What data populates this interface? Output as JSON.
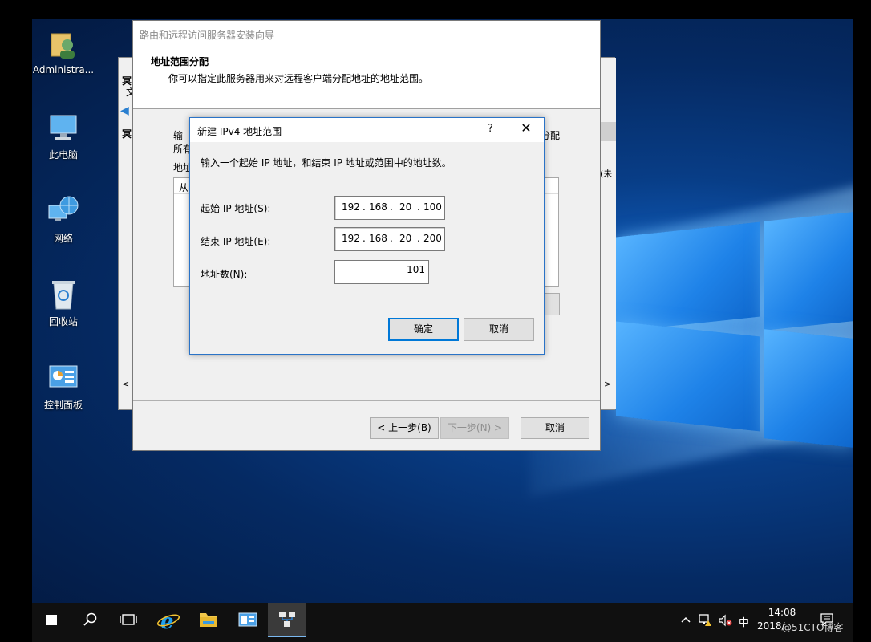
{
  "desktop": {
    "icons": [
      {
        "label": "Administra..."
      },
      {
        "label": "此电脑"
      },
      {
        "label": "网络"
      },
      {
        "label": "回收站"
      },
      {
        "label": "控制面板"
      }
    ]
  },
  "console_partial": {
    "char1": "冥",
    "char2": "文",
    "char3": "冥",
    "right_text": "(未"
  },
  "wizard": {
    "title": "路由和远程访问服务器安装向导",
    "header_title": "地址范围分配",
    "header_desc": "你可以指定此服务器用来对远程客户端分配地址的地址范围。",
    "body_line1": "输",
    "body_line2": "所有",
    "body_line1_right": "分配",
    "list_label": "地址",
    "list_col": "从",
    "back_button": "< 上一步(B)",
    "next_button": "下一步(N) >",
    "cancel_button": "取消"
  },
  "dialog": {
    "title": "新建 IPv4 地址范围",
    "help": "?",
    "close": "✕",
    "instruction": "输入一个起始 IP 地址，和结束 IP 地址或范围中的地址数。",
    "start_label": "起始 IP 地址(S):",
    "start_ip": [
      "192",
      "168",
      "20",
      "100"
    ],
    "end_label": "结束 IP 地址(E):",
    "end_ip": [
      "192",
      "168",
      "20",
      "200"
    ],
    "count_label": "地址数(N):",
    "count_value": "101",
    "ok_button": "确定",
    "cancel_button": "取消"
  },
  "taskbar": {
    "ime": "中",
    "time": "14:08",
    "date": "2018/",
    "watermark": "@51CTO博客"
  },
  "colors": {
    "accent": "#0078d7",
    "dialog_border": "#2a73c7",
    "taskbar": "#101010"
  }
}
